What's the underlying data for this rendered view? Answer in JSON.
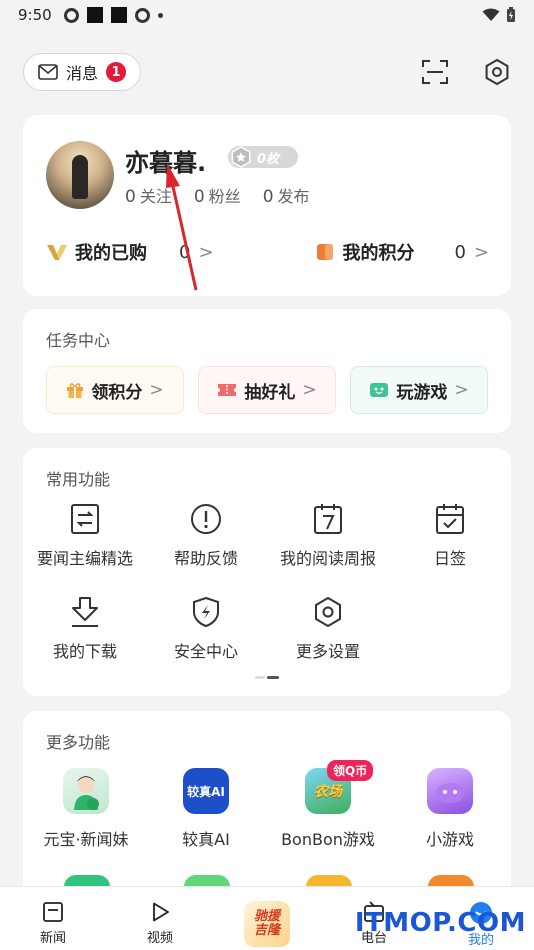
{
  "status_bar": {
    "time": "9:50"
  },
  "header": {
    "messages_label": "消息",
    "messages_badge": "1"
  },
  "profile": {
    "username": "亦暮暮.",
    "level_badge": "0枚",
    "stats": [
      {
        "value": "0",
        "label": "关注"
      },
      {
        "value": "0",
        "label": "粉丝"
      },
      {
        "value": "0",
        "label": "发布"
      }
    ],
    "purchased": {
      "label": "我的已购",
      "value": "0",
      "chevron": ">"
    },
    "points": {
      "label": "我的积分",
      "value": "0",
      "chevron": ">"
    }
  },
  "task_center": {
    "title": "任务中心",
    "buttons": [
      {
        "label": "领积分",
        "chevron": ">"
      },
      {
        "label": "抽好礼",
        "chevron": ">"
      },
      {
        "label": "玩游戏",
        "chevron": ">"
      }
    ]
  },
  "common_functions": {
    "title": "常用功能",
    "items": [
      {
        "label": "要闻主编精选",
        "icon": "editor-pick-icon"
      },
      {
        "label": "帮助反馈",
        "icon": "help-feedback-icon"
      },
      {
        "label": "我的阅读周报",
        "icon": "weekly-report-icon"
      },
      {
        "label": "日签",
        "icon": "daily-sign-icon"
      },
      {
        "label": "我的下载",
        "icon": "download-icon"
      },
      {
        "label": "安全中心",
        "icon": "security-shield-icon"
      },
      {
        "label": "更多设置",
        "icon": "settings-hexagon-icon"
      }
    ]
  },
  "more_functions": {
    "title": "更多功能",
    "items": [
      {
        "label": "元宝·新闻妹",
        "icon": "yuanbao-news-icon"
      },
      {
        "label": "较真AI",
        "icon": "jiaozhen-ai-icon",
        "icon_text": "较真AI"
      },
      {
        "label": "BonBon游戏",
        "icon": "bonbon-game-icon",
        "badge": "领Q币",
        "icon_text": "农场"
      },
      {
        "label": "小游戏",
        "icon": "mini-game-icon"
      }
    ]
  },
  "bottom_nav": {
    "items": [
      {
        "label": "新闻",
        "icon": "news-icon"
      },
      {
        "label": "视频",
        "icon": "video-play-icon"
      },
      {
        "label": "电台",
        "icon": "radio-icon"
      },
      {
        "label": "我的",
        "icon": "profile-icon"
      }
    ],
    "center_logo_text": "驰援吉隆"
  },
  "watermark": "ITMOP.COM",
  "colors": {
    "accent_red": "#e5193a",
    "watermark_blue": "#1a56d6",
    "annotation_arrow": "#d9262c"
  }
}
